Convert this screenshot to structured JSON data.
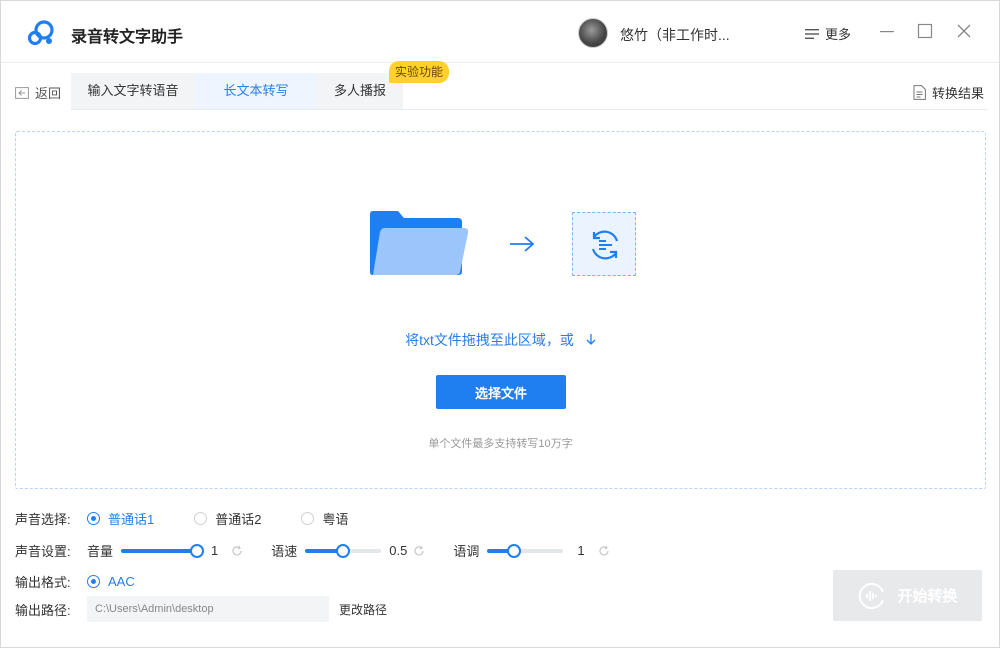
{
  "app": {
    "title": "录音转文字助手"
  },
  "user": {
    "name": "悠竹（非工作时..."
  },
  "header": {
    "more_label": "更多"
  },
  "nav": {
    "back_label": "返回",
    "tabs": [
      {
        "label": "输入文字转语音"
      },
      {
        "label": "长文本转写",
        "active": true
      },
      {
        "label": "多人播报"
      }
    ],
    "badge": "实验功能",
    "result_label": "转换结果"
  },
  "dropzone": {
    "hint": "将txt文件拖拽至此区域，或",
    "choose_button": "选择文件",
    "limit_note": "单个文件最多支持转写10万字"
  },
  "voice": {
    "label": "声音选择:",
    "options": [
      {
        "label": "普通话1",
        "selected": true
      },
      {
        "label": "普通话2",
        "selected": false
      },
      {
        "label": "粤语",
        "selected": false
      }
    ]
  },
  "sound": {
    "label": "声音设置:",
    "volume": {
      "label": "音量",
      "value": "1",
      "fraction": 1.0
    },
    "speed": {
      "label": "语速",
      "value": "0.5",
      "fraction": 0.5
    },
    "pitch": {
      "label": "语调",
      "value": "1",
      "fraction": 0.35
    }
  },
  "format": {
    "label": "输出格式:",
    "option": "AAC"
  },
  "output_path": {
    "label": "输出路径:",
    "value": "C:\\Users\\Admin\\desktop",
    "change_label": "更改路径"
  },
  "start_button": "开始转换",
  "colors": {
    "accent": "#1f7ff0",
    "badge": "#ffd02e",
    "disabled": "#e8e9eb"
  }
}
